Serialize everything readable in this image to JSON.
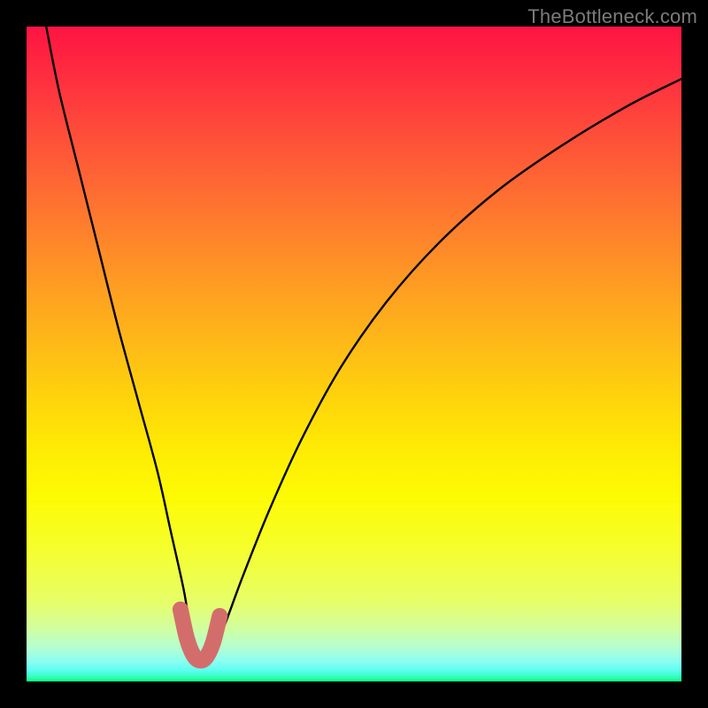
{
  "watermark": "TheBottleneck.com",
  "chart_data": {
    "type": "line",
    "title": "",
    "xlabel": "",
    "ylabel": "",
    "xlim": [
      0,
      100
    ],
    "ylim": [
      0,
      100
    ],
    "grid": false,
    "series": [
      {
        "name": "bottleneck-curve",
        "color": "#000000",
        "x": [
          3,
          5,
          8,
          11,
          14,
          17,
          20,
          22,
          24,
          25,
          26,
          27,
          28,
          30,
          33,
          37,
          42,
          48,
          55,
          63,
          72,
          82,
          92,
          100
        ],
        "values": [
          100,
          90,
          78,
          66,
          54,
          43,
          32,
          23,
          14,
          8,
          4,
          3,
          4,
          8,
          16,
          26,
          37,
          48,
          58,
          67,
          75,
          82,
          88,
          92
        ]
      },
      {
        "name": "highlight-trough",
        "color": "#d36d6b",
        "x": [
          23.5,
          24.5,
          25.5,
          26.5,
          27.5,
          28.5,
          29.5
        ],
        "values": [
          11,
          6.5,
          4,
          3.2,
          3.8,
          6,
          10
        ]
      }
    ],
    "background_gradient": {
      "stops": [
        {
          "pos": 0.0,
          "color": "#fd1442"
        },
        {
          "pos": 0.5,
          "color": "#fecc0f"
        },
        {
          "pos": 0.8,
          "color": "#f3fe33"
        },
        {
          "pos": 1.0,
          "color": "#13fe7e"
        }
      ]
    }
  }
}
